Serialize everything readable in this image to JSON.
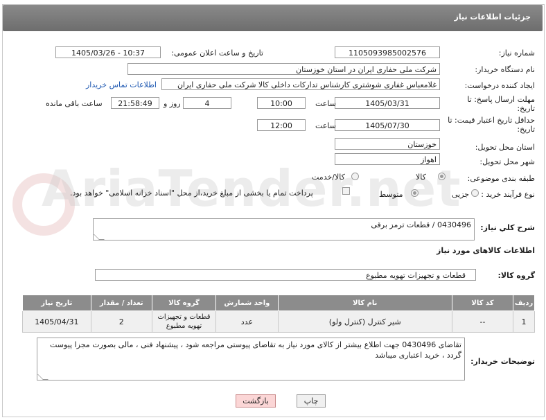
{
  "title": "جزئیات اطلاعات نیاز",
  "watermark": "AriaTender.net",
  "fields": {
    "need_number_label": "شماره نیاز:",
    "need_number": "1105093985002576",
    "announce_label": "تاریخ و ساعت اعلان عمومی:",
    "announce_value": "1405/03/26 - 10:37",
    "buyer_label": "نام دستگاه خریدار:",
    "buyer_value": "شرکت ملی حفاری ایران در استان خوزستان",
    "creator_label": "ایجاد کننده درخواست:",
    "creator_value": "غلامعباس غفاری شوشتری کارشناس تدارکات داخلی کالا شرکت ملی حفاری ایران",
    "contact_link": "اطلاعات تماس خریدار",
    "deadline_label": "مهلت ارسال پاسخ: تا تاریخ:",
    "deadline_date": "1405/03/31",
    "time_label": "ساعت",
    "deadline_time": "10:00",
    "days_value": "4",
    "days_label": "روز و",
    "remaining_time": "21:58:49",
    "remaining_label": "ساعت باقی مانده",
    "validity_label": "حداقل تاریخ اعتبار قیمت: تا تاریخ:",
    "validity_date": "1405/07/30",
    "validity_time_label": "ساعت",
    "validity_time": "12:00",
    "province_label": "استان محل تحویل:",
    "province_value": "خوزستان",
    "city_label": "شهر محل تحویل:",
    "city_value": "اهواز",
    "category_label": "طبقه بندی موضوعی:",
    "category_options": [
      "کالا",
      "کالا/خدمت"
    ],
    "process_label": "نوع فرآیند خرید :",
    "process_options": [
      "جزیی",
      "متوسط"
    ],
    "payment_text": "پرداخت تمام یا بخشی از مبلغ خرید،از محل \"اسناد خزانه اسلامی\" خواهد بود."
  },
  "summary": {
    "label": "شرح کلي نياز:",
    "value": "0430496 / قطعات ترمز برقی"
  },
  "goods_section_title": "اطلاعات کالاهای مورد نیاز",
  "goods_group": {
    "label": "گروه کالا:",
    "value": "قطعات و تجهیزات تهویه مطبوع"
  },
  "table": {
    "headers": [
      "ردیف",
      "کد کالا",
      "نام کالا",
      "واحد شمارش",
      "گروه کالا",
      "تعداد / مقدار",
      "تاریخ نیاز"
    ],
    "rows": [
      [
        "1",
        "--",
        "شیر کنترل (کنترل ولو)",
        "عدد",
        "قطعات و تجهیزات تهویه مطبوع",
        "2",
        "1405/04/31"
      ]
    ]
  },
  "buyer_notes": {
    "label": "توضیحات خریدار:",
    "value": "تقاضای 0430496 جهت اطلاع بیشتر از کالای مورد نیاز به تقاضای پیوستی مراجعه شود ، پیشنهاد فنی ، مالی بصورت مجزا پیوست گردد ، خرید اعتباری میباشد"
  },
  "buttons": {
    "print": "چاپ",
    "back": "بازگشت"
  }
}
